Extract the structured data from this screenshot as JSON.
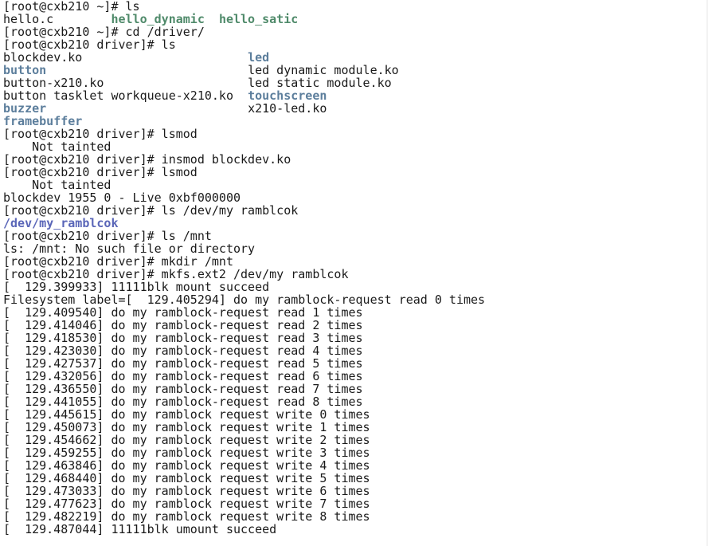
{
  "colors": {
    "background": "#ffffff",
    "text": "#1a1a1a",
    "directory": "#5c7e9c",
    "executable": "#4f8a6a",
    "device": "#5a66b8"
  },
  "terminal": {
    "lines": [
      {
        "segments": [
          {
            "text": "[root@cxb210 ~]# ls"
          }
        ]
      },
      {
        "segments": [
          {
            "text": "hello.c",
            "col": 0
          },
          {
            "text": "hello_dynamic",
            "col": 15,
            "color": "executable"
          },
          {
            "text": "hello_satic",
            "col": 30,
            "color": "executable"
          }
        ]
      },
      {
        "segments": [
          {
            "text": "[root@cxb210 ~]# cd /driver/"
          }
        ]
      },
      {
        "segments": [
          {
            "text": "[root@cxb210 driver]# ls"
          }
        ]
      },
      {
        "segments": [
          {
            "text": "blockdev.ko",
            "col": 0
          },
          {
            "text": "led",
            "col": 34,
            "color": "directory"
          }
        ]
      },
      {
        "segments": [
          {
            "text": "button",
            "col": 0,
            "color": "directory"
          },
          {
            "text": "led_dynamic_module.ko",
            "col": 34
          }
        ]
      },
      {
        "segments": [
          {
            "text": "button-x210.ko",
            "col": 0
          },
          {
            "text": "led_static_module.ko",
            "col": 34
          }
        ]
      },
      {
        "segments": [
          {
            "text": "button_tasklet_workqueue-x210.ko",
            "col": 0
          },
          {
            "text": "touchscreen",
            "col": 34,
            "color": "directory"
          }
        ]
      },
      {
        "segments": [
          {
            "text": "buzzer",
            "col": 0,
            "color": "directory"
          },
          {
            "text": "x210-led.ko",
            "col": 34
          }
        ]
      },
      {
        "segments": [
          {
            "text": "framebuffer",
            "color": "directory"
          }
        ]
      },
      {
        "segments": [
          {
            "text": "[root@cxb210 driver]# lsmod"
          }
        ]
      },
      {
        "segments": [
          {
            "text": "    Not tainted"
          }
        ]
      },
      {
        "segments": [
          {
            "text": "[root@cxb210 driver]# insmod blockdev.ko"
          }
        ]
      },
      {
        "segments": [
          {
            "text": "[root@cxb210 driver]# lsmod"
          }
        ]
      },
      {
        "segments": [
          {
            "text": "    Not tainted"
          }
        ]
      },
      {
        "segments": [
          {
            "text": "blockdev 1955 0 - Live 0xbf000000"
          }
        ]
      },
      {
        "segments": [
          {
            "text": "[root@cxb210 driver]# ls /dev/my_ramblcok"
          }
        ]
      },
      {
        "segments": [
          {
            "text": "/dev/my_ramblcok",
            "color": "device"
          }
        ]
      },
      {
        "segments": [
          {
            "text": "[root@cxb210 driver]# ls /mnt"
          }
        ]
      },
      {
        "segments": [
          {
            "text": "ls: /mnt: No such file or directory"
          }
        ]
      },
      {
        "segments": [
          {
            "text": "[root@cxb210 driver]# mkdir /mnt"
          }
        ]
      },
      {
        "segments": [
          {
            "text": "[root@cxb210 driver]# mkfs.ext2 /dev/my_ramblcok"
          }
        ]
      },
      {
        "segments": [
          {
            "text": "[  129.399933] 11111blk mount succeed"
          }
        ]
      },
      {
        "segments": [
          {
            "text": "Filesystem label=[  129.405294] do_my_ramblock-request read 0 times"
          }
        ]
      },
      {
        "segments": [
          {
            "text": "[  129.409540] do_my_ramblock-request read 1 times"
          }
        ]
      },
      {
        "segments": [
          {
            "text": "[  129.414046] do_my_ramblock-request read 2 times"
          }
        ]
      },
      {
        "segments": [
          {
            "text": "[  129.418530] do_my_ramblock-request read 3 times"
          }
        ]
      },
      {
        "segments": [
          {
            "text": "[  129.423030] do_my_ramblock-request read 4 times"
          }
        ]
      },
      {
        "segments": [
          {
            "text": "[  129.427537] do_my_ramblock-request read 5 times"
          }
        ]
      },
      {
        "segments": [
          {
            "text": "[  129.432056] do_my_ramblock-request read 6 times"
          }
        ]
      },
      {
        "segments": [
          {
            "text": "[  129.436550] do_my_ramblock-request read 7 times"
          }
        ]
      },
      {
        "segments": [
          {
            "text": "[  129.441055] do_my_ramblock-request read 8 times"
          }
        ]
      },
      {
        "segments": [
          {
            "text": "[  129.445615] do_my_ramblock request write 0 times"
          }
        ]
      },
      {
        "segments": [
          {
            "text": "[  129.450073] do_my_ramblock request write 1 times"
          }
        ]
      },
      {
        "segments": [
          {
            "text": "[  129.454662] do_my_ramblock request write 2 times"
          }
        ]
      },
      {
        "segments": [
          {
            "text": "[  129.459255] do_my_ramblock request write 3 times"
          }
        ]
      },
      {
        "segments": [
          {
            "text": "[  129.463846] do_my_ramblock request write 4 times"
          }
        ]
      },
      {
        "segments": [
          {
            "text": "[  129.468440] do_my_ramblock request write 5 times"
          }
        ]
      },
      {
        "segments": [
          {
            "text": "[  129.473033] do_my_ramblock request write 6 times"
          }
        ]
      },
      {
        "segments": [
          {
            "text": "[  129.477623] do_my_ramblock request write 7 times"
          }
        ]
      },
      {
        "segments": [
          {
            "text": "[  129.482219] do_my_ramblock request write 8 times"
          }
        ]
      },
      {
        "segments": [
          {
            "text": "[  129.487044] 11111blk umount succeed"
          }
        ]
      }
    ]
  }
}
